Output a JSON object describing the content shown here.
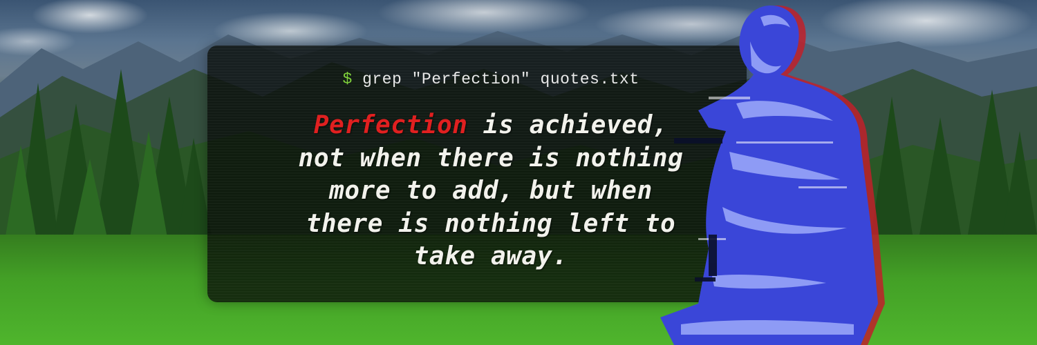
{
  "terminal": {
    "prompt_symbol": "$",
    "command": "grep \"Perfection\" quotes.txt"
  },
  "quote": {
    "highlight_word": "Perfection",
    "line1_rest": " is achieved,",
    "line2": "not when there is nothing",
    "line3": "more to add, but when",
    "line4": "there is nothing left to",
    "line5": "take away."
  },
  "colors": {
    "prompt": "#7fd13b",
    "highlight": "#e02020",
    "quote_text": "#f2f2ec",
    "statue": "#3a46d8"
  },
  "images": {
    "background": "mountain-meadow-landscape",
    "figure": "glitched-seated-philosopher-statue"
  }
}
